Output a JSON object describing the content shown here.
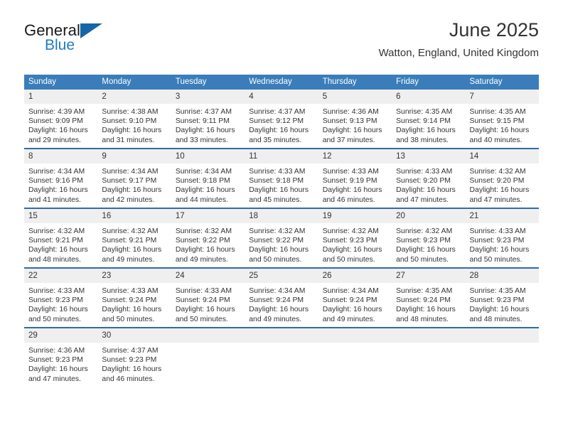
{
  "brand": {
    "line1": "General",
    "line2": "Blue",
    "accent_color": "#1565a8",
    "blue_text_color": "#1f7ac0"
  },
  "header": {
    "title": "June 2025",
    "subtitle": "Watton, England, United Kingdom"
  },
  "theme": {
    "header_blue": "#3a7dba",
    "row_divider_blue": "#2f6ca8",
    "daynum_band": "#efefef"
  },
  "calendar": {
    "weekday_headers": [
      "Sunday",
      "Monday",
      "Tuesday",
      "Wednesday",
      "Thursday",
      "Friday",
      "Saturday"
    ],
    "weeks": [
      [
        {
          "day": "1",
          "sunrise": "Sunrise: 4:39 AM",
          "sunset": "Sunset: 9:09 PM",
          "daylight_line1": "Daylight: 16 hours",
          "daylight_line2": "and 29 minutes."
        },
        {
          "day": "2",
          "sunrise": "Sunrise: 4:38 AM",
          "sunset": "Sunset: 9:10 PM",
          "daylight_line1": "Daylight: 16 hours",
          "daylight_line2": "and 31 minutes."
        },
        {
          "day": "3",
          "sunrise": "Sunrise: 4:37 AM",
          "sunset": "Sunset: 9:11 PM",
          "daylight_line1": "Daylight: 16 hours",
          "daylight_line2": "and 33 minutes."
        },
        {
          "day": "4",
          "sunrise": "Sunrise: 4:37 AM",
          "sunset": "Sunset: 9:12 PM",
          "daylight_line1": "Daylight: 16 hours",
          "daylight_line2": "and 35 minutes."
        },
        {
          "day": "5",
          "sunrise": "Sunrise: 4:36 AM",
          "sunset": "Sunset: 9:13 PM",
          "daylight_line1": "Daylight: 16 hours",
          "daylight_line2": "and 37 minutes."
        },
        {
          "day": "6",
          "sunrise": "Sunrise: 4:35 AM",
          "sunset": "Sunset: 9:14 PM",
          "daylight_line1": "Daylight: 16 hours",
          "daylight_line2": "and 38 minutes."
        },
        {
          "day": "7",
          "sunrise": "Sunrise: 4:35 AM",
          "sunset": "Sunset: 9:15 PM",
          "daylight_line1": "Daylight: 16 hours",
          "daylight_line2": "and 40 minutes."
        }
      ],
      [
        {
          "day": "8",
          "sunrise": "Sunrise: 4:34 AM",
          "sunset": "Sunset: 9:16 PM",
          "daylight_line1": "Daylight: 16 hours",
          "daylight_line2": "and 41 minutes."
        },
        {
          "day": "9",
          "sunrise": "Sunrise: 4:34 AM",
          "sunset": "Sunset: 9:17 PM",
          "daylight_line1": "Daylight: 16 hours",
          "daylight_line2": "and 42 minutes."
        },
        {
          "day": "10",
          "sunrise": "Sunrise: 4:34 AM",
          "sunset": "Sunset: 9:18 PM",
          "daylight_line1": "Daylight: 16 hours",
          "daylight_line2": "and 44 minutes."
        },
        {
          "day": "11",
          "sunrise": "Sunrise: 4:33 AM",
          "sunset": "Sunset: 9:18 PM",
          "daylight_line1": "Daylight: 16 hours",
          "daylight_line2": "and 45 minutes."
        },
        {
          "day": "12",
          "sunrise": "Sunrise: 4:33 AM",
          "sunset": "Sunset: 9:19 PM",
          "daylight_line1": "Daylight: 16 hours",
          "daylight_line2": "and 46 minutes."
        },
        {
          "day": "13",
          "sunrise": "Sunrise: 4:33 AM",
          "sunset": "Sunset: 9:20 PM",
          "daylight_line1": "Daylight: 16 hours",
          "daylight_line2": "and 47 minutes."
        },
        {
          "day": "14",
          "sunrise": "Sunrise: 4:32 AM",
          "sunset": "Sunset: 9:20 PM",
          "daylight_line1": "Daylight: 16 hours",
          "daylight_line2": "and 47 minutes."
        }
      ],
      [
        {
          "day": "15",
          "sunrise": "Sunrise: 4:32 AM",
          "sunset": "Sunset: 9:21 PM",
          "daylight_line1": "Daylight: 16 hours",
          "daylight_line2": "and 48 minutes."
        },
        {
          "day": "16",
          "sunrise": "Sunrise: 4:32 AM",
          "sunset": "Sunset: 9:21 PM",
          "daylight_line1": "Daylight: 16 hours",
          "daylight_line2": "and 49 minutes."
        },
        {
          "day": "17",
          "sunrise": "Sunrise: 4:32 AM",
          "sunset": "Sunset: 9:22 PM",
          "daylight_line1": "Daylight: 16 hours",
          "daylight_line2": "and 49 minutes."
        },
        {
          "day": "18",
          "sunrise": "Sunrise: 4:32 AM",
          "sunset": "Sunset: 9:22 PM",
          "daylight_line1": "Daylight: 16 hours",
          "daylight_line2": "and 50 minutes."
        },
        {
          "day": "19",
          "sunrise": "Sunrise: 4:32 AM",
          "sunset": "Sunset: 9:23 PM",
          "daylight_line1": "Daylight: 16 hours",
          "daylight_line2": "and 50 minutes."
        },
        {
          "day": "20",
          "sunrise": "Sunrise: 4:32 AM",
          "sunset": "Sunset: 9:23 PM",
          "daylight_line1": "Daylight: 16 hours",
          "daylight_line2": "and 50 minutes."
        },
        {
          "day": "21",
          "sunrise": "Sunrise: 4:33 AM",
          "sunset": "Sunset: 9:23 PM",
          "daylight_line1": "Daylight: 16 hours",
          "daylight_line2": "and 50 minutes."
        }
      ],
      [
        {
          "day": "22",
          "sunrise": "Sunrise: 4:33 AM",
          "sunset": "Sunset: 9:23 PM",
          "daylight_line1": "Daylight: 16 hours",
          "daylight_line2": "and 50 minutes."
        },
        {
          "day": "23",
          "sunrise": "Sunrise: 4:33 AM",
          "sunset": "Sunset: 9:24 PM",
          "daylight_line1": "Daylight: 16 hours",
          "daylight_line2": "and 50 minutes."
        },
        {
          "day": "24",
          "sunrise": "Sunrise: 4:33 AM",
          "sunset": "Sunset: 9:24 PM",
          "daylight_line1": "Daylight: 16 hours",
          "daylight_line2": "and 50 minutes."
        },
        {
          "day": "25",
          "sunrise": "Sunrise: 4:34 AM",
          "sunset": "Sunset: 9:24 PM",
          "daylight_line1": "Daylight: 16 hours",
          "daylight_line2": "and 49 minutes."
        },
        {
          "day": "26",
          "sunrise": "Sunrise: 4:34 AM",
          "sunset": "Sunset: 9:24 PM",
          "daylight_line1": "Daylight: 16 hours",
          "daylight_line2": "and 49 minutes."
        },
        {
          "day": "27",
          "sunrise": "Sunrise: 4:35 AM",
          "sunset": "Sunset: 9:24 PM",
          "daylight_line1": "Daylight: 16 hours",
          "daylight_line2": "and 48 minutes."
        },
        {
          "day": "28",
          "sunrise": "Sunrise: 4:35 AM",
          "sunset": "Sunset: 9:23 PM",
          "daylight_line1": "Daylight: 16 hours",
          "daylight_line2": "and 48 minutes."
        }
      ],
      [
        {
          "day": "29",
          "sunrise": "Sunrise: 4:36 AM",
          "sunset": "Sunset: 9:23 PM",
          "daylight_line1": "Daylight: 16 hours",
          "daylight_line2": "and 47 minutes."
        },
        {
          "day": "30",
          "sunrise": "Sunrise: 4:37 AM",
          "sunset": "Sunset: 9:23 PM",
          "daylight_line1": "Daylight: 16 hours",
          "daylight_line2": "and 46 minutes."
        },
        {
          "day": "",
          "sunrise": "",
          "sunset": "",
          "daylight_line1": "",
          "daylight_line2": ""
        },
        {
          "day": "",
          "sunrise": "",
          "sunset": "",
          "daylight_line1": "",
          "daylight_line2": ""
        },
        {
          "day": "",
          "sunrise": "",
          "sunset": "",
          "daylight_line1": "",
          "daylight_line2": ""
        },
        {
          "day": "",
          "sunrise": "",
          "sunset": "",
          "daylight_line1": "",
          "daylight_line2": ""
        },
        {
          "day": "",
          "sunrise": "",
          "sunset": "",
          "daylight_line1": "",
          "daylight_line2": ""
        }
      ]
    ]
  }
}
